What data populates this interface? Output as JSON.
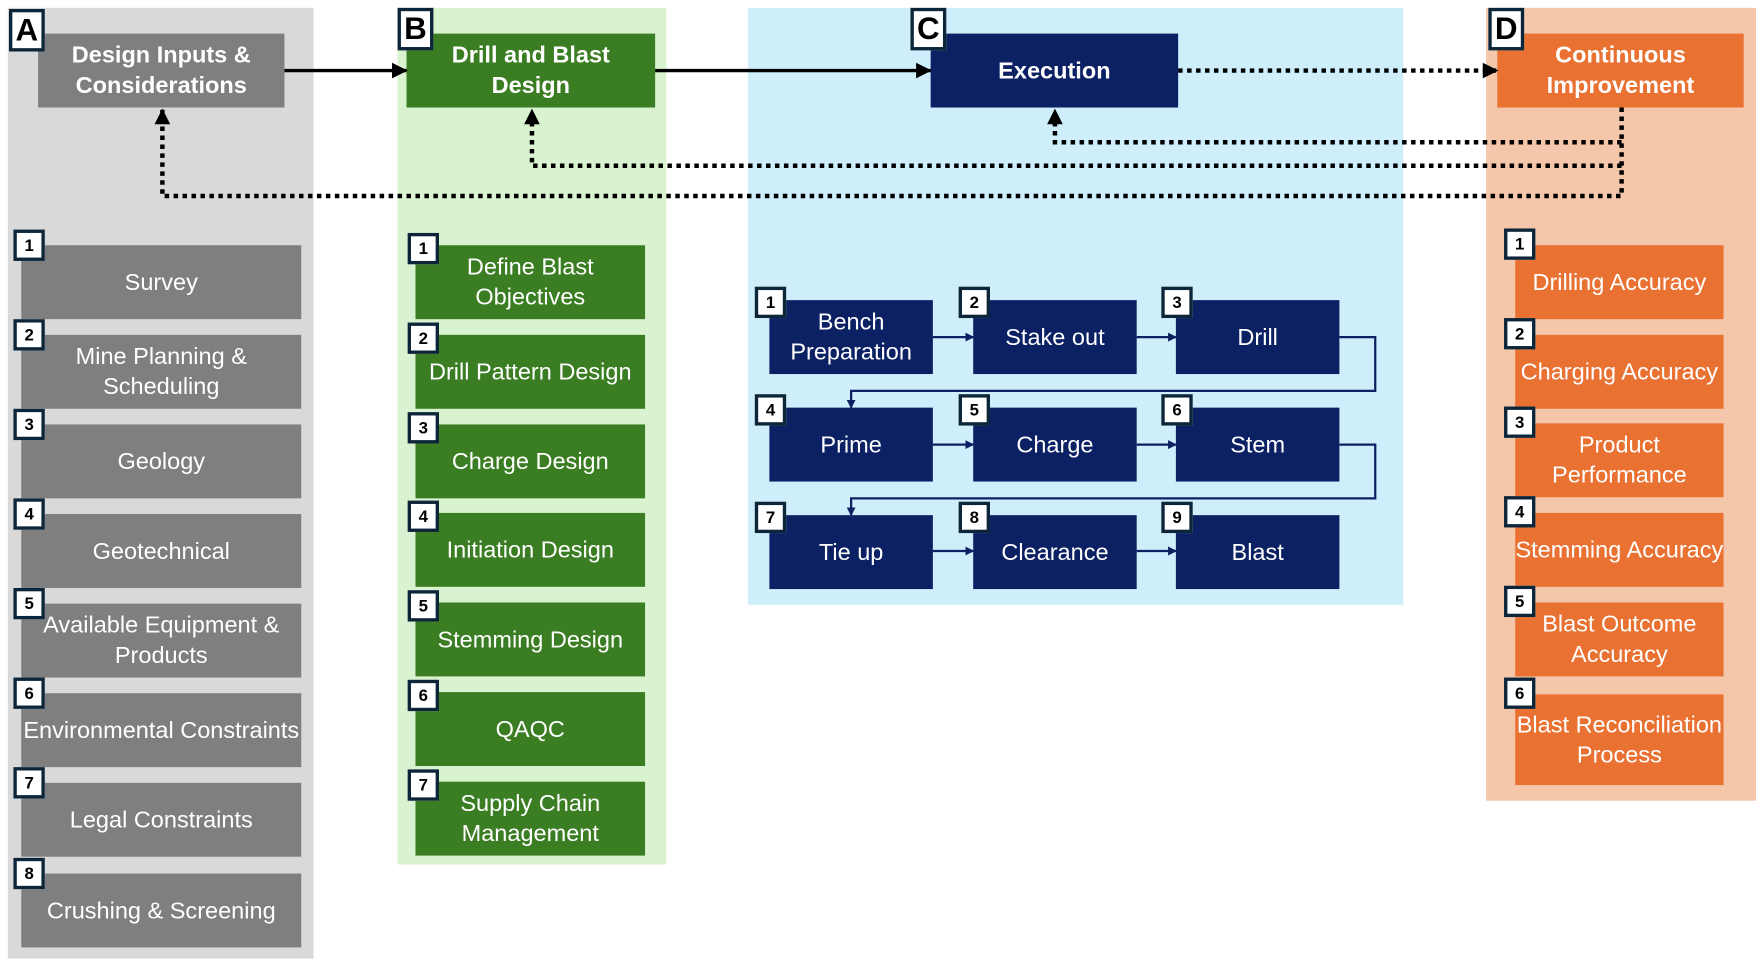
{
  "colors": {
    "a_bg": "#d9d9d9",
    "a_box": "#7f7f7f",
    "b_bg": "#d9f2d0",
    "b_box": "#3a7d22",
    "c_bg": "#cdeefa",
    "c_box": "#0c2163",
    "d_bg": "#f4c6aa",
    "d_box": "#e97132"
  },
  "sections": [
    {
      "letter": "A",
      "title": "Design Inputs & Considerations",
      "items": [
        "Survey",
        "Mine Planning & Scheduling",
        "Geology",
        "Geotechnical",
        "Available Equipment & Products",
        "Environmental Constraints",
        "Legal Constraints",
        "Crushing & Screening"
      ]
    },
    {
      "letter": "B",
      "title": "Drill and Blast Design",
      "items": [
        "Define Blast Objectives",
        "Drill Pattern Design",
        "Charge Design",
        "Initiation Design",
        "Stemming Design",
        "QAQC",
        "Supply Chain Management"
      ]
    },
    {
      "letter": "C",
      "title": "Execution",
      "items": [
        "Bench Preparation",
        "Stake out",
        "Drill",
        "Prime",
        "Charge",
        "Stem",
        "Tie up",
        "Clearance",
        "Blast"
      ]
    },
    {
      "letter": "D",
      "title": "Continuous Improvement",
      "items": [
        "Drilling Accuracy",
        "Charging Accuracy",
        "Product Performance",
        "Stemming Accuracy",
        "Blast Outcome Accuracy",
        "Blast Reconciliation Process"
      ]
    }
  ],
  "numbers": [
    "1",
    "2",
    "3",
    "4",
    "5",
    "6",
    "7",
    "8",
    "9"
  ]
}
